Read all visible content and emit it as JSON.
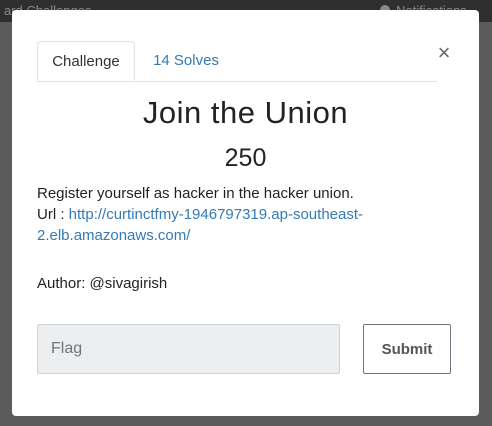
{
  "background": {
    "breadcrumb": "ard   Challenges",
    "notifications_label": "Notifications"
  },
  "modal": {
    "tabs": [
      {
        "label": "Challenge",
        "active": true
      },
      {
        "label": "14 Solves",
        "active": false
      }
    ],
    "close_symbol": "×",
    "title": "Join the Union",
    "points": "250",
    "description": {
      "line1": "Register yourself as hacker in the hacker union.",
      "url_prefix": "Url : ",
      "url_part1": "http://curtinctfmy-1946797319.ap-southeast-",
      "url_part2": "2.elb.amazonaws.com/"
    },
    "author": "Author: @sivagirish",
    "flag_placeholder": "Flag",
    "submit_label": "Submit"
  },
  "colors": {
    "link": "#337ab7",
    "overlay": "#5b5b5b"
  }
}
